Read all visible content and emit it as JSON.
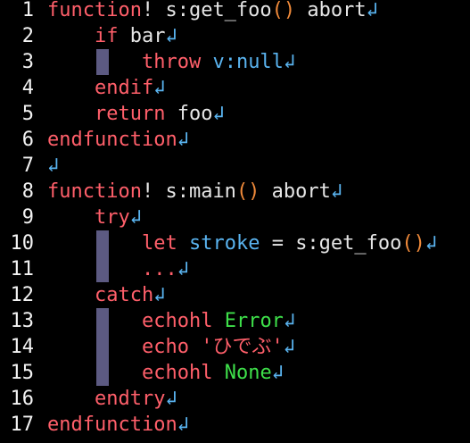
{
  "theme": {
    "background": "#000000",
    "keyword": "#ff5f6a",
    "plain": "#e6e6e6",
    "paren": "#f08a3a",
    "variable": "#5ab4f0",
    "green": "#3ee04a",
    "indent_guide": "#5c5a82"
  },
  "eol_marker": "↲",
  "lines": [
    {
      "n": "1",
      "tokens": [
        [
          "keyword",
          "function"
        ],
        [
          "plain",
          "! s:get_foo"
        ],
        [
          "paren",
          "()"
        ],
        [
          "plain",
          " abort"
        ]
      ]
    },
    {
      "n": "2",
      "tokens": [
        [
          "plain",
          "    "
        ],
        [
          "keyword",
          "if"
        ],
        [
          "plain",
          " bar"
        ]
      ]
    },
    {
      "n": "3",
      "tokens": [
        [
          "plain",
          "        "
        ],
        [
          "keyword",
          "throw"
        ],
        [
          "plain",
          " "
        ],
        [
          "var",
          "v:null"
        ]
      ]
    },
    {
      "n": "4",
      "tokens": [
        [
          "plain",
          "    "
        ],
        [
          "keyword",
          "endif"
        ]
      ]
    },
    {
      "n": "5",
      "tokens": [
        [
          "plain",
          "    "
        ],
        [
          "keyword",
          "return"
        ],
        [
          "plain",
          " foo"
        ]
      ]
    },
    {
      "n": "6",
      "tokens": [
        [
          "keyword",
          "endfunction"
        ]
      ]
    },
    {
      "n": "7",
      "tokens": []
    },
    {
      "n": "8",
      "tokens": [
        [
          "keyword",
          "function"
        ],
        [
          "plain",
          "! s:main"
        ],
        [
          "paren",
          "()"
        ],
        [
          "plain",
          " abort"
        ]
      ]
    },
    {
      "n": "9",
      "tokens": [
        [
          "plain",
          "    "
        ],
        [
          "keyword",
          "try"
        ]
      ]
    },
    {
      "n": "10",
      "tokens": [
        [
          "plain",
          "        "
        ],
        [
          "keyword",
          "let"
        ],
        [
          "plain",
          " "
        ],
        [
          "var",
          "stroke"
        ],
        [
          "plain",
          " = s:get_foo"
        ],
        [
          "paren",
          "()"
        ]
      ]
    },
    {
      "n": "11",
      "tokens": [
        [
          "plain",
          "        "
        ],
        [
          "dots",
          "..."
        ]
      ]
    },
    {
      "n": "12",
      "tokens": [
        [
          "plain",
          "    "
        ],
        [
          "keyword",
          "catch"
        ]
      ]
    },
    {
      "n": "13",
      "tokens": [
        [
          "plain",
          "        "
        ],
        [
          "keyword",
          "echohl"
        ],
        [
          "plain",
          " "
        ],
        [
          "green",
          "Error"
        ]
      ]
    },
    {
      "n": "14",
      "tokens": [
        [
          "plain",
          "        "
        ],
        [
          "keyword",
          "echo"
        ],
        [
          "plain",
          " "
        ],
        [
          "string",
          "'ひでぶ'"
        ]
      ]
    },
    {
      "n": "15",
      "tokens": [
        [
          "plain",
          "        "
        ],
        [
          "keyword",
          "echohl"
        ],
        [
          "plain",
          " "
        ],
        [
          "green",
          "None"
        ]
      ]
    },
    {
      "n": "16",
      "tokens": [
        [
          "plain",
          "    "
        ],
        [
          "keyword",
          "endtry"
        ]
      ]
    },
    {
      "n": "17",
      "tokens": [
        [
          "keyword",
          "endfunction"
        ]
      ]
    }
  ]
}
